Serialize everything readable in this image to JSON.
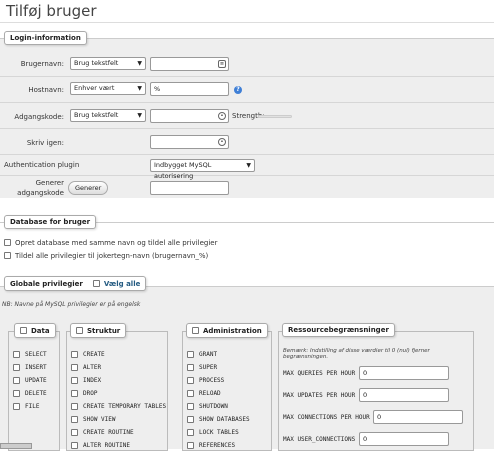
{
  "page": {
    "title": "Tilføj bruger"
  },
  "login": {
    "legend": "Login-information",
    "username": {
      "label": "Brugernavn:",
      "select": "Brug tekstfelt",
      "value": ""
    },
    "host": {
      "label": "Hostnavn:",
      "select": "Enhver vært",
      "value": "%"
    },
    "password": {
      "label": "Adgangskode:",
      "select": "Brug tekstfelt",
      "value": "",
      "strength_label": "Strength:"
    },
    "retype": {
      "label": "Skriv igen:",
      "value": ""
    },
    "auth": {
      "label": "Authentication plugin",
      "select": "Indbygget MySQL autorisering"
    },
    "generate": {
      "label_line1": "Generer",
      "label_line2": "adgangskode",
      "button": "Generer",
      "value": ""
    }
  },
  "database": {
    "legend": "Database for bruger",
    "options": [
      "Opret database med samme navn og tildel alle privilegier",
      "Tildel alle privilegier til jokertegn-navn (brugernavn_%)"
    ]
  },
  "global": {
    "legend": "Globale privilegier",
    "check_all": "Vælg alle",
    "note": "NB: Navne på MySQL privilegier er på engelsk",
    "data": {
      "legend": "Data",
      "items": [
        "SELECT",
        "INSERT",
        "UPDATE",
        "DELETE",
        "FILE"
      ]
    },
    "structure": {
      "legend": "Struktur",
      "items": [
        "CREATE",
        "ALTER",
        "INDEX",
        "DROP",
        "CREATE TEMPORARY TABLES",
        "SHOW VIEW",
        "CREATE ROUTINE",
        "ALTER ROUTINE"
      ]
    },
    "admin": {
      "legend": "Administration",
      "items": [
        "GRANT",
        "SUPER",
        "PROCESS",
        "RELOAD",
        "SHUTDOWN",
        "SHOW DATABASES",
        "LOCK TABLES",
        "REFERENCES"
      ]
    },
    "resources": {
      "legend": "Ressourcebegrænsninger",
      "note": "Bemærk: Indstilling af disse værdier til 0 (nul) fjerner begrænsningen.",
      "rows": [
        {
          "label": "MAX QUERIES PER HOUR",
          "value": "0"
        },
        {
          "label": "MAX UPDATES PER HOUR",
          "value": "0"
        },
        {
          "label": "MAX CONNECTIONS PER HOUR",
          "value": "0"
        },
        {
          "label": "MAX USER_CONNECTIONS",
          "value": "0"
        }
      ]
    }
  }
}
